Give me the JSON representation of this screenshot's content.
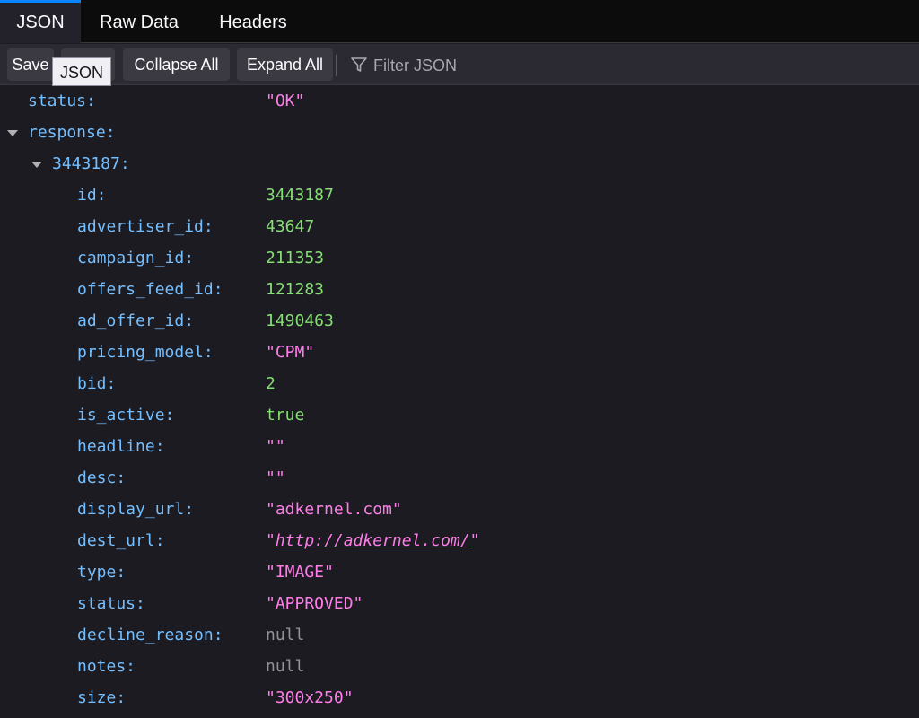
{
  "tabs": [
    {
      "label": "JSON",
      "active": true
    },
    {
      "label": "Raw Data",
      "active": false
    },
    {
      "label": "Headers",
      "active": false
    }
  ],
  "toolbar": {
    "save_label": "Save",
    "copy_label": "",
    "collapse_label": "Collapse All",
    "expand_label": "Expand All",
    "filter_placeholder": "Filter JSON",
    "tooltip": "JSON"
  },
  "tree": {
    "status": {
      "key": "status:",
      "value": "\"OK\""
    },
    "response": {
      "key": "response:"
    },
    "item": {
      "key": "3443187:",
      "fields": [
        {
          "key": "id:",
          "value": "3443187",
          "type": "number"
        },
        {
          "key": "advertiser_id:",
          "value": "43647",
          "type": "number"
        },
        {
          "key": "campaign_id:",
          "value": "211353",
          "type": "number"
        },
        {
          "key": "offers_feed_id:",
          "value": "121283",
          "type": "number"
        },
        {
          "key": "ad_offer_id:",
          "value": "1490463",
          "type": "number"
        },
        {
          "key": "pricing_model:",
          "value": "\"CPM\"",
          "type": "string"
        },
        {
          "key": "bid:",
          "value": "2",
          "type": "number"
        },
        {
          "key": "is_active:",
          "value": "true",
          "type": "bool"
        },
        {
          "key": "headline:",
          "value": "\"\"",
          "type": "string"
        },
        {
          "key": "desc:",
          "value": "\"\"",
          "type": "string"
        },
        {
          "key": "display_url:",
          "value": "\"adkernel.com\"",
          "type": "string"
        },
        {
          "key": "dest_url:",
          "value": "http://adkernel.com/",
          "type": "link"
        },
        {
          "key": "type:",
          "value": "\"IMAGE\"",
          "type": "string"
        },
        {
          "key": "status:",
          "value": "\"APPROVED\"",
          "type": "string"
        },
        {
          "key": "decline_reason:",
          "value": "null",
          "type": "null"
        },
        {
          "key": "notes:",
          "value": "null",
          "type": "null"
        },
        {
          "key": "size:",
          "value": "\"300x250\"",
          "type": "string"
        }
      ]
    }
  },
  "colors": {
    "key": "#75bfff",
    "string": "#ff7de9",
    "number": "#86de74",
    "null": "#939395",
    "accent": "#0a84ff"
  }
}
